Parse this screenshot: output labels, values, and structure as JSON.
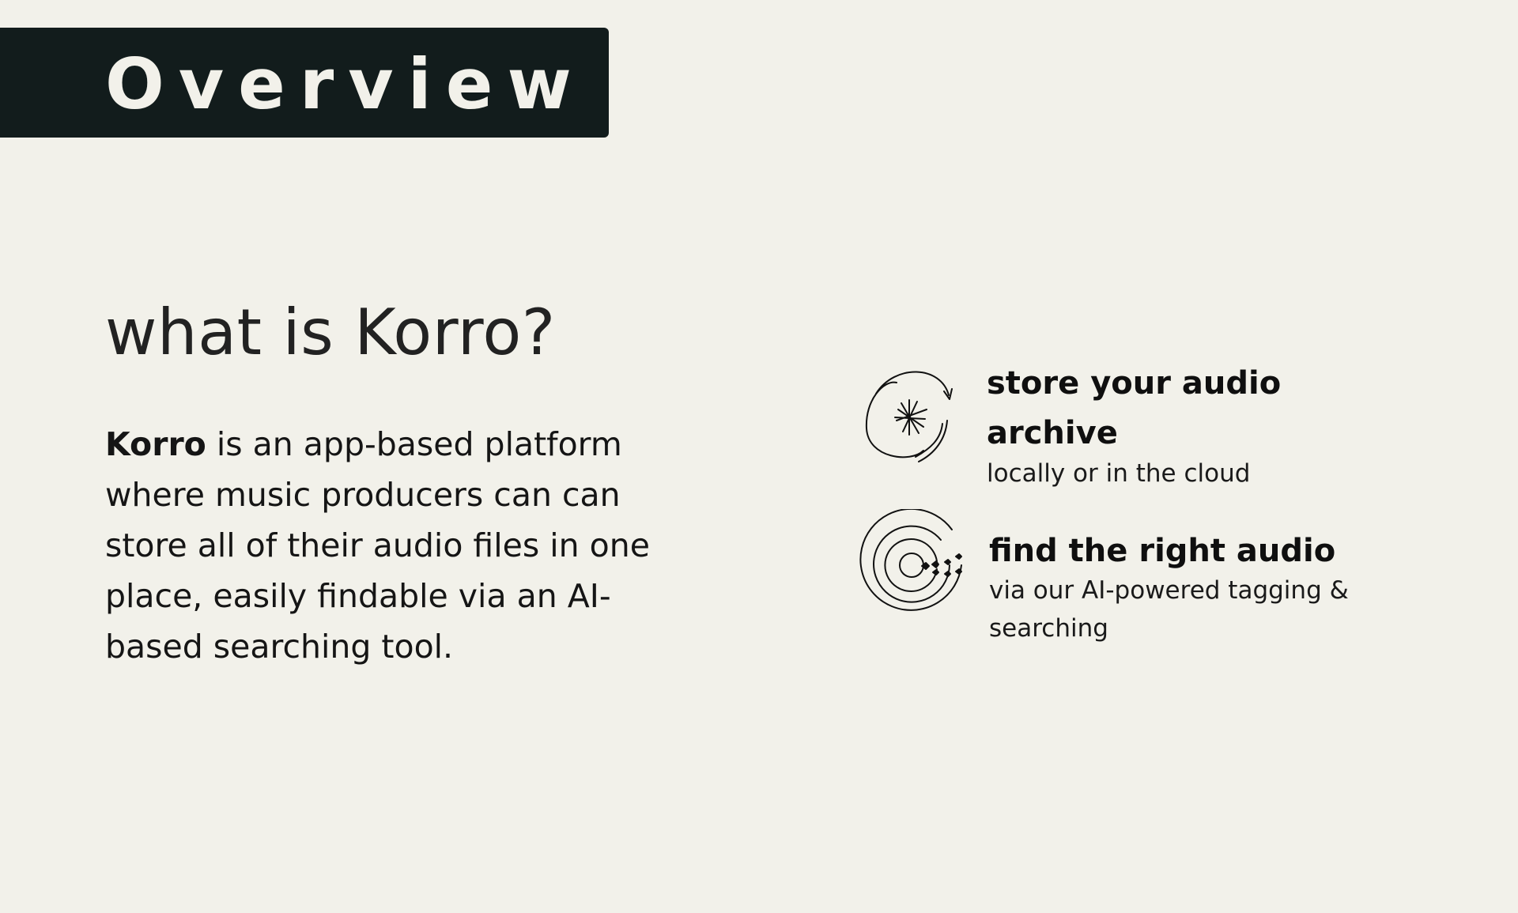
{
  "header": {
    "title": "Overview"
  },
  "intro": {
    "heading": "what is Korro?",
    "brand": "Korro",
    "description": " is an app-based platform where music producers can can store all of their audio files in one place, easily findable via an AI-based searching tool."
  },
  "features": [
    {
      "icon": "cycle-spark-icon",
      "title": "store your audio archive",
      "subtitle": "locally or in the cloud"
    },
    {
      "icon": "target-rings-icon",
      "title": "find the right audio",
      "subtitle": "via our AI-powered tagging & searching"
    }
  ],
  "colors": {
    "background": "#f2f1ea",
    "banner": "#121c1c",
    "banner_text": "#f2f1ea",
    "text": "#111111"
  }
}
